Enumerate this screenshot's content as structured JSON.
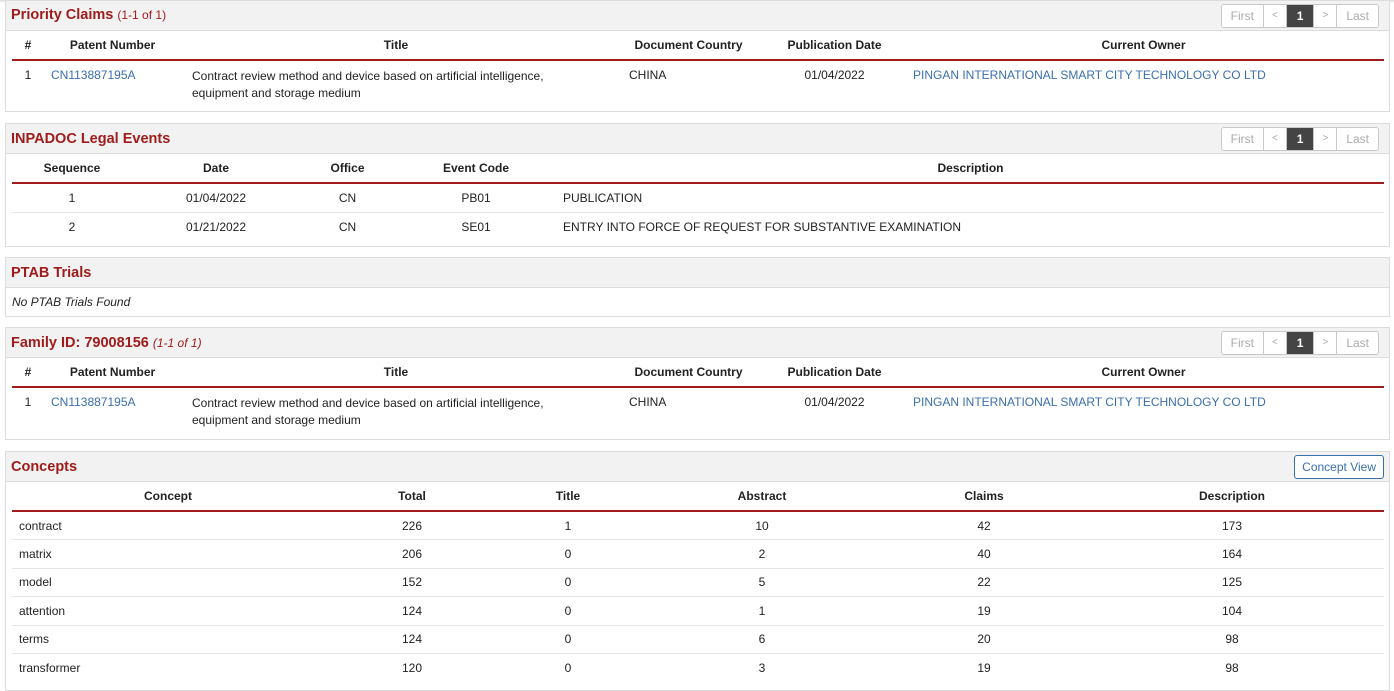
{
  "priority_claims": {
    "title": "Priority Claims",
    "count": "(1-1 of 1)",
    "pager": {
      "first": "First",
      "prev": "<",
      "page": "1",
      "next": ">",
      "last": "Last"
    },
    "headers": [
      "#",
      "Patent Number",
      "Title",
      "Document Country",
      "Publication Date",
      "Current Owner"
    ],
    "rows": [
      {
        "num": "1",
        "patent": "CN113887195A",
        "title": "Contract review method and device based on artificial intelligence, equipment and storage medium",
        "country": "CHINA",
        "date": "01/04/2022",
        "owner": "PINGAN INTERNATIONAL SMART CITY TECHNOLOGY CO LTD"
      }
    ]
  },
  "inpadoc": {
    "title": "INPADOC Legal Events",
    "pager": {
      "first": "First",
      "prev": "<",
      "page": "1",
      "next": ">",
      "last": "Last"
    },
    "headers": [
      "Sequence",
      "Date",
      "Office",
      "Event Code",
      "Description"
    ],
    "rows": [
      {
        "seq": "1",
        "date": "01/04/2022",
        "office": "CN",
        "code": "PB01",
        "desc": "PUBLICATION"
      },
      {
        "seq": "2",
        "date": "01/21/2022",
        "office": "CN",
        "code": "SE01",
        "desc": "ENTRY INTO FORCE OF REQUEST FOR SUBSTANTIVE EXAMINATION"
      }
    ]
  },
  "ptab": {
    "title": "PTAB Trials",
    "empty": "No PTAB Trials Found"
  },
  "family": {
    "title": "Family ID: 79008156",
    "count": "(1-1 of 1)",
    "pager": {
      "first": "First",
      "prev": "<",
      "page": "1",
      "next": ">",
      "last": "Last"
    },
    "headers": [
      "#",
      "Patent Number",
      "Title",
      "Document Country",
      "Publication Date",
      "Current Owner"
    ],
    "rows": [
      {
        "num": "1",
        "patent": "CN113887195A",
        "title": "Contract review method and device based on artificial intelligence, equipment and storage medium",
        "country": "CHINA",
        "date": "01/04/2022",
        "owner": "PINGAN INTERNATIONAL SMART CITY TECHNOLOGY CO LTD"
      }
    ]
  },
  "concepts": {
    "title": "Concepts",
    "view_button": "Concept View",
    "headers": [
      "Concept",
      "Total",
      "Title",
      "Abstract",
      "Claims",
      "Description"
    ],
    "rows": [
      {
        "concept": "contract",
        "total": "226",
        "title": "1",
        "abstract": "10",
        "claims": "42",
        "description": "173"
      },
      {
        "concept": "matrix",
        "total": "206",
        "title": "0",
        "abstract": "2",
        "claims": "40",
        "description": "164"
      },
      {
        "concept": "model",
        "total": "152",
        "title": "0",
        "abstract": "5",
        "claims": "22",
        "description": "125"
      },
      {
        "concept": "attention",
        "total": "124",
        "title": "0",
        "abstract": "1",
        "claims": "19",
        "description": "104"
      },
      {
        "concept": "terms",
        "total": "124",
        "title": "0",
        "abstract": "6",
        "claims": "20",
        "description": "98"
      },
      {
        "concept": "transformer",
        "total": "120",
        "title": "0",
        "abstract": "3",
        "claims": "19",
        "description": "98"
      }
    ]
  },
  "colors": {
    "accent": "#a01c1c",
    "link": "#3a6fae",
    "header_bg": "#f2f2f2"
  }
}
